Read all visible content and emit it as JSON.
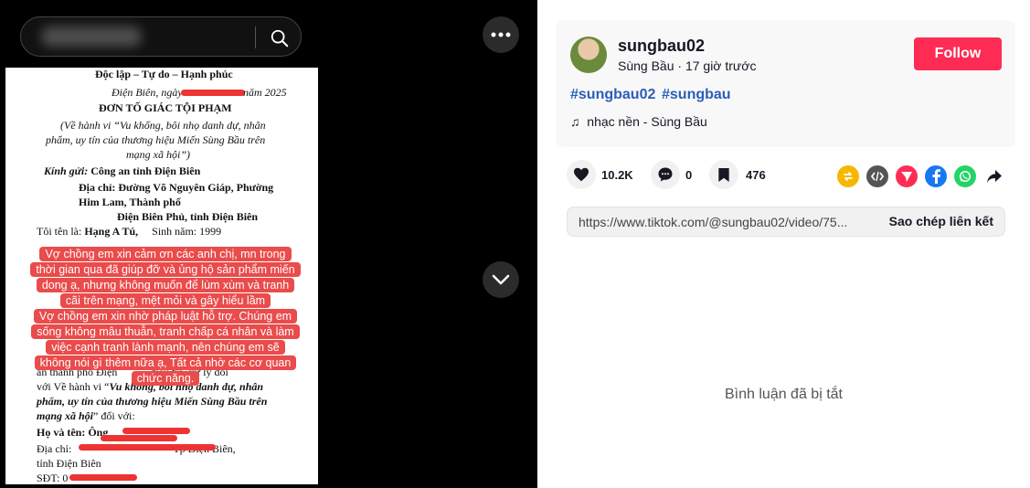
{
  "search": {
    "blurred_query": "ng phước"
  },
  "video": {
    "doc": {
      "header": "Độc lập – Tự do – Hạnh phúc",
      "date": "Điện Biên, ngày",
      "date_year": "năm 2025",
      "title": "ĐƠN TỐ GIÁC TỘI PHẠM",
      "subtitle_1": "(Về hành vi “Vu khống, bôi nhọ danh dự, nhân",
      "subtitle_2": "phẩm, uy tín của thương hiệu Miến Sùng Bầu trên",
      "subtitle_3": "mạng xã hội”)",
      "kinh_gui_label": "Kính gửi:",
      "kinh_gui_value": "Công an tỉnh Điện Biên",
      "addr_1": "Địa chỉ: Đường Võ Nguyên Giáp, Phường",
      "addr_2": "Him Lam, Thành phố",
      "addr_3": "Điện Biên Phủ, tỉnh Điện Biên",
      "toi_ten": "Tôi tên là:",
      "toi_ten_value": "Hạng A Tú,",
      "sinh_nam": "Sinh năm: 1999",
      "body_1": "an thành phố Điện",
      "body_1b": "điều tra, xử lý đối",
      "body_2": "với Về hành vi “",
      "body_2b": "Vu khống, bôi nhọ danh dự, nhân",
      "body_3": "phẩm, uy tín của thương hiệu Miến Sùng Bầu trên",
      "body_4": "mạng xã hội",
      "body_4b": "” đối với:",
      "ho_ten": "Họ và tên: Ông",
      "dia_chi": "Địa chỉ:",
      "dia_chi_b": "Tp Điện Biên,",
      "tinh": "tỉnh Điện Biên",
      "sdt": "SĐT: 0"
    },
    "caption_lines": [
      "Vợ chồng em xin cảm ơn các anh chị, mn trong",
      "thời gian qua đã giúp đỡ và ủng hộ sản phẩm miến",
      "dong ạ, nhưng không muốn để lùm xùm và tranh",
      "cãi trên mạng, mệt mỏi và gây hiểu lầm",
      "Vợ chồng em xin nhờ pháp luật hỗ trợ. Chúng em",
      "sống không mâu thuẫn, tranh chấp cá nhân và làm",
      "việc cạnh tranh lành mạnh, nên chúng em sẽ",
      "không nói gì thêm nữa ạ, Tất cả nhờ các cơ quan",
      "chức năng."
    ]
  },
  "author": {
    "username": "sungbau02",
    "nickname": "Sùng Bầu",
    "separator": "·",
    "posted": "17 giờ trước",
    "follow_label": "Follow"
  },
  "hashtags": [
    "#sungbau02",
    "#sungbau"
  ],
  "music": {
    "icon": "♫",
    "label": "nhạc nền - Sùng Bầu"
  },
  "actions": {
    "likes": "10.2K",
    "comments": "0",
    "saves": "476"
  },
  "link": {
    "url": "https://www.tiktok.com/@sungbau02/video/75...",
    "copy_label": "Sao chép liên kết"
  },
  "comments_off": "Bình luận đã bị tắt",
  "colors": {
    "follow": "#fe2c55",
    "hashtag": "#2b5db9",
    "caption_bg": "#ea4b4b"
  },
  "icons": [
    "search-icon",
    "more-icon",
    "chevron-down-icon",
    "heart-icon",
    "comment-icon",
    "bookmark-icon",
    "repost-icon",
    "embed-icon",
    "send-icon",
    "facebook-icon",
    "whatsapp-icon",
    "share-arrow-icon",
    "music-note-icon"
  ]
}
